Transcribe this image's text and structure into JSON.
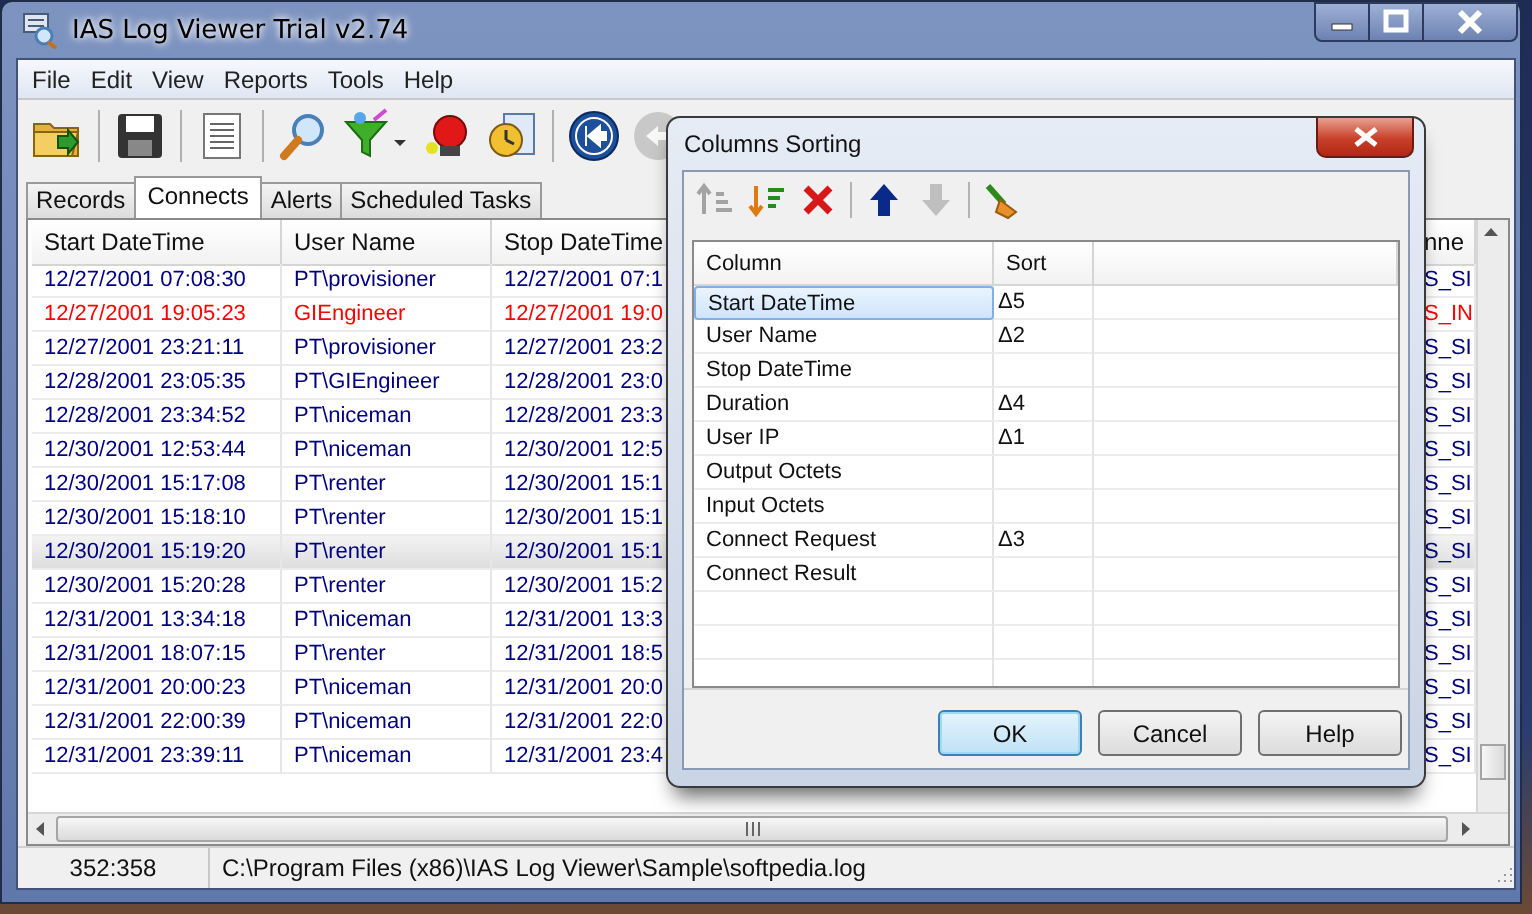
{
  "window": {
    "title": "IAS Log Viewer Trial v2.74"
  },
  "menu": [
    "File",
    "Edit",
    "View",
    "Reports",
    "Tools",
    "Help"
  ],
  "toolbar": [
    {
      "kind": "open",
      "disabled": false
    },
    {
      "kind": "save",
      "disabled": false
    },
    {
      "kind": "document",
      "disabled": false
    },
    {
      "kind": "search",
      "disabled": false
    },
    {
      "kind": "filter",
      "disabled": false
    },
    {
      "kind": "alarm",
      "disabled": false
    },
    {
      "kind": "report",
      "disabled": false
    },
    {
      "kind": "first",
      "disabled": false
    },
    {
      "kind": "back",
      "disabled": true
    }
  ],
  "tabs": [
    {
      "label": "Records",
      "selected": false
    },
    {
      "label": "Connects",
      "selected": true
    },
    {
      "label": "Alerts",
      "selected": false
    },
    {
      "label": "Scheduled Tasks",
      "selected": false
    }
  ],
  "grid": {
    "columns": [
      "Start DateTime",
      "User Name",
      "Stop DateTime",
      "nne"
    ],
    "rows": [
      {
        "cells": [
          "12/27/2001 07:08:30",
          "PT\\provisioner",
          "12/27/2001 07:1",
          "S_SI"
        ],
        "color": "#000080",
        "selected": false
      },
      {
        "cells": [
          "12/27/2001 19:05:23",
          "GIEngineer",
          "12/27/2001 19:0",
          "S_IN"
        ],
        "color": "#ff0000",
        "selected": false
      },
      {
        "cells": [
          "12/27/2001 23:21:11",
          "PT\\provisioner",
          "12/27/2001 23:2",
          "S_SI"
        ],
        "color": "#000080",
        "selected": false
      },
      {
        "cells": [
          "12/28/2001 23:05:35",
          "PT\\GIEngineer",
          "12/28/2001 23:0",
          "S_SI"
        ],
        "color": "#000080",
        "selected": false
      },
      {
        "cells": [
          "12/28/2001 23:34:52",
          "PT\\niceman",
          "12/28/2001 23:3",
          "S_SI"
        ],
        "color": "#000080",
        "selected": false
      },
      {
        "cells": [
          "12/30/2001 12:53:44",
          "PT\\niceman",
          "12/30/2001 12:5",
          "S_SI"
        ],
        "color": "#000080",
        "selected": false
      },
      {
        "cells": [
          "12/30/2001 15:17:08",
          "PT\\renter",
          "12/30/2001 15:1",
          "S_SI"
        ],
        "color": "#000080",
        "selected": false
      },
      {
        "cells": [
          "12/30/2001 15:18:10",
          "PT\\renter",
          "12/30/2001 15:1",
          "S_SI"
        ],
        "color": "#000080",
        "selected": false
      },
      {
        "cells": [
          "12/30/2001 15:19:20",
          "PT\\renter",
          "12/30/2001 15:1",
          "S_SI"
        ],
        "color": "#000080",
        "selected": true
      },
      {
        "cells": [
          "12/30/2001 15:20:28",
          "PT\\renter",
          "12/30/2001 15:2",
          "S_SI"
        ],
        "color": "#000080",
        "selected": false
      },
      {
        "cells": [
          "12/31/2001 13:34:18",
          "PT\\niceman",
          "12/31/2001 13:3",
          "S_SI"
        ],
        "color": "#000080",
        "selected": false
      },
      {
        "cells": [
          "12/31/2001 18:07:15",
          "PT\\renter",
          "12/31/2001 18:5",
          "S_SI"
        ],
        "color": "#000080",
        "selected": false
      },
      {
        "cells": [
          "12/31/2001 20:00:23",
          "PT\\niceman",
          "12/31/2001 20:0",
          "S_SI"
        ],
        "color": "#000080",
        "selected": false
      },
      {
        "cells": [
          "12/31/2001 22:00:39",
          "PT\\niceman",
          "12/31/2001 22:0",
          "S_SI"
        ],
        "color": "#000080",
        "selected": false
      },
      {
        "cells": [
          "12/31/2001 23:39:11",
          "PT\\niceman",
          "12/31/2001 23:4",
          "S_SI"
        ],
        "color": "#000080",
        "selected": false
      }
    ]
  },
  "status": {
    "position": "352:358",
    "path": "C:\\Program Files (x86)\\IAS Log Viewer\\Sample\\softpedia.log"
  },
  "dialog": {
    "title": "Columns Sorting",
    "toolbar": [
      {
        "kind": "sort-asc",
        "disabled": true
      },
      {
        "kind": "sort-desc",
        "disabled": false
      },
      {
        "kind": "delete",
        "disabled": false
      },
      {
        "kind": "up",
        "disabled": false
      },
      {
        "kind": "down",
        "disabled": true
      },
      {
        "kind": "clear",
        "disabled": false
      }
    ],
    "columns": [
      "Column",
      "Sort"
    ],
    "rows": [
      {
        "name": "Start DateTime",
        "order": "Δ5",
        "selected": true
      },
      {
        "name": "User Name",
        "order": "Δ2",
        "selected": false
      },
      {
        "name": "Stop DateTime",
        "selected": false
      },
      {
        "name": "Duration",
        "order": "Δ4",
        "selected": false
      },
      {
        "name": "User IP",
        "order": "Δ1",
        "selected": false
      },
      {
        "name": "Output Octets",
        "selected": false
      },
      {
        "name": "Input Octets",
        "selected": false
      },
      {
        "name": "Connect Request",
        "order": "Δ3",
        "selected": false
      },
      {
        "name": "Connect Result",
        "selected": false
      }
    ],
    "buttons": [
      {
        "label": "OK",
        "default": true
      },
      {
        "label": "Cancel",
        "default": false
      },
      {
        "label": "Help",
        "default": false
      }
    ]
  }
}
